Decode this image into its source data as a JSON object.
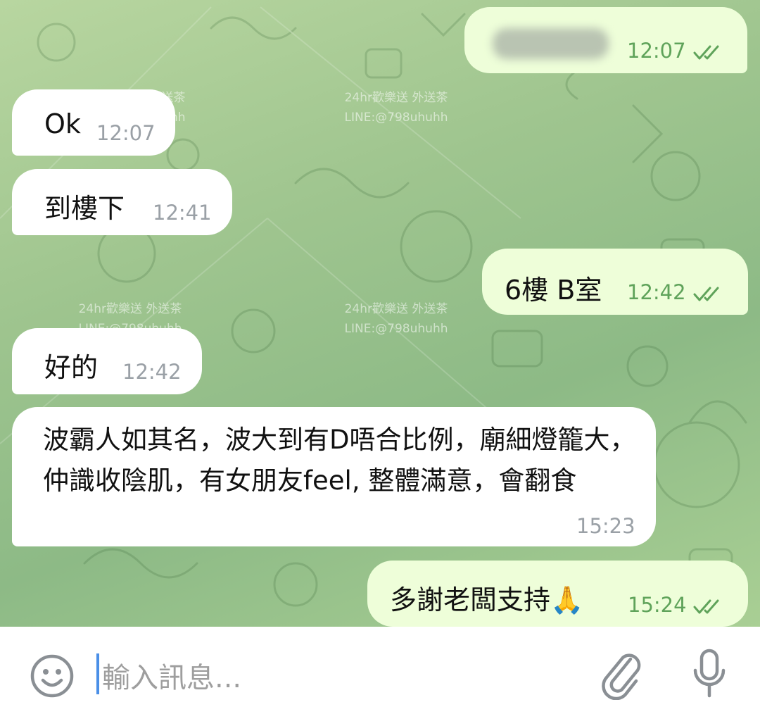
{
  "watermark": {
    "line1": "24hr歡樂送 外送茶",
    "line2": "LINE:@798uhuhh"
  },
  "messages": [
    {
      "direction": "out",
      "text": "",
      "time": "12:07",
      "status": "read",
      "blurred": true
    },
    {
      "direction": "in",
      "text": "Ok",
      "time": "12:07"
    },
    {
      "direction": "in",
      "text": "到樓下",
      "time": "12:41"
    },
    {
      "direction": "out",
      "text": "6樓 B室",
      "time": "12:42",
      "status": "read"
    },
    {
      "direction": "in",
      "text": "好的",
      "time": "12:42"
    },
    {
      "direction": "in",
      "text": "波霸人如其名，波大到有D唔合比例，廟細燈籠大，仲識收陰肌，有女朋友feel, 整體滿意，會翻食",
      "time": "15:23"
    },
    {
      "direction": "out",
      "text": "多謝老闆支持🙏",
      "time": "15:24",
      "status": "read"
    }
  ],
  "composer": {
    "placeholder": "輸入訊息...",
    "emoji_icon": "emoji-icon",
    "attach_icon": "paperclip-icon",
    "mic_icon": "microphone-icon"
  },
  "colors": {
    "incoming_bubble": "#ffffff",
    "outgoing_bubble": "#eefed9",
    "outgoing_time": "#5fa35a",
    "incoming_time": "#9aa0a6",
    "caret": "#4a8fe7"
  }
}
